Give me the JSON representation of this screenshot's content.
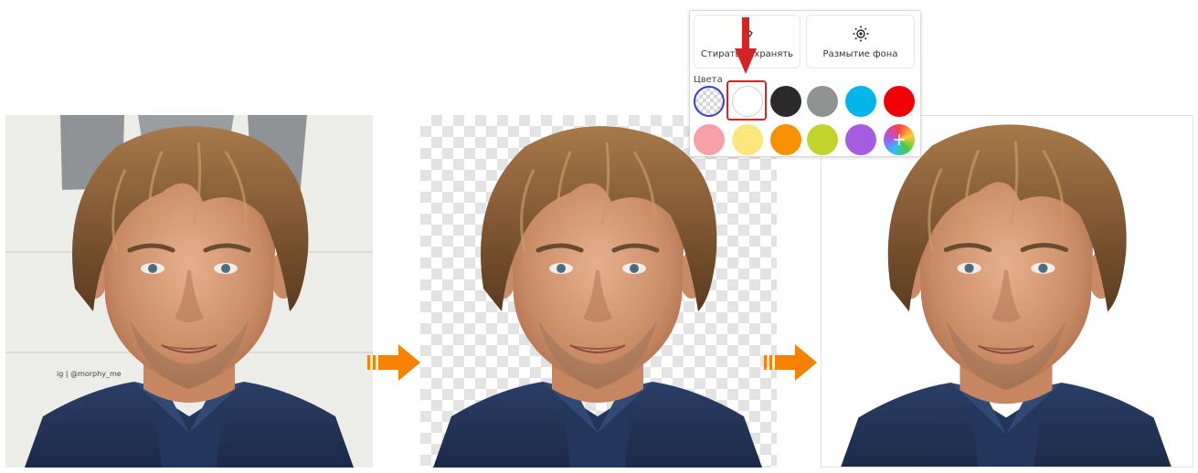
{
  "panels": {
    "original": {
      "watermark": "ig | @morphy_me",
      "background_color": "#ecece8"
    },
    "transparent": {
      "background": "checkerboard"
    },
    "white": {
      "background_color": "#ffffff"
    }
  },
  "flow_arrows": {
    "color": "#f78200",
    "icon": "right-arrow-icon"
  },
  "popup": {
    "options": [
      {
        "label": "Стирать/сохранять",
        "icon": "eraser-icon"
      },
      {
        "label": "Размытие фона",
        "icon": "blur-icon"
      }
    ],
    "colors_label": "Цвета",
    "swatches": [
      {
        "name": "transparent",
        "color": "transparent",
        "selected": true
      },
      {
        "name": "white",
        "color": "#ffffff",
        "highlighted": true
      },
      {
        "name": "black",
        "color": "#2a2a2a"
      },
      {
        "name": "gray",
        "color": "#8f9291"
      },
      {
        "name": "cyan",
        "color": "#00b5ea"
      },
      {
        "name": "red",
        "color": "#f20008"
      },
      {
        "name": "pink",
        "color": "#f7a0a6"
      },
      {
        "name": "yellow",
        "color": "#fbe77e"
      },
      {
        "name": "orange",
        "color": "#f79100"
      },
      {
        "name": "lime",
        "color": "#c2d42b"
      },
      {
        "name": "purple",
        "color": "#a55de0"
      },
      {
        "name": "custom",
        "color": "conic-gradient",
        "icon": "plus-icon"
      }
    ],
    "pointer_color": "#d42424"
  }
}
